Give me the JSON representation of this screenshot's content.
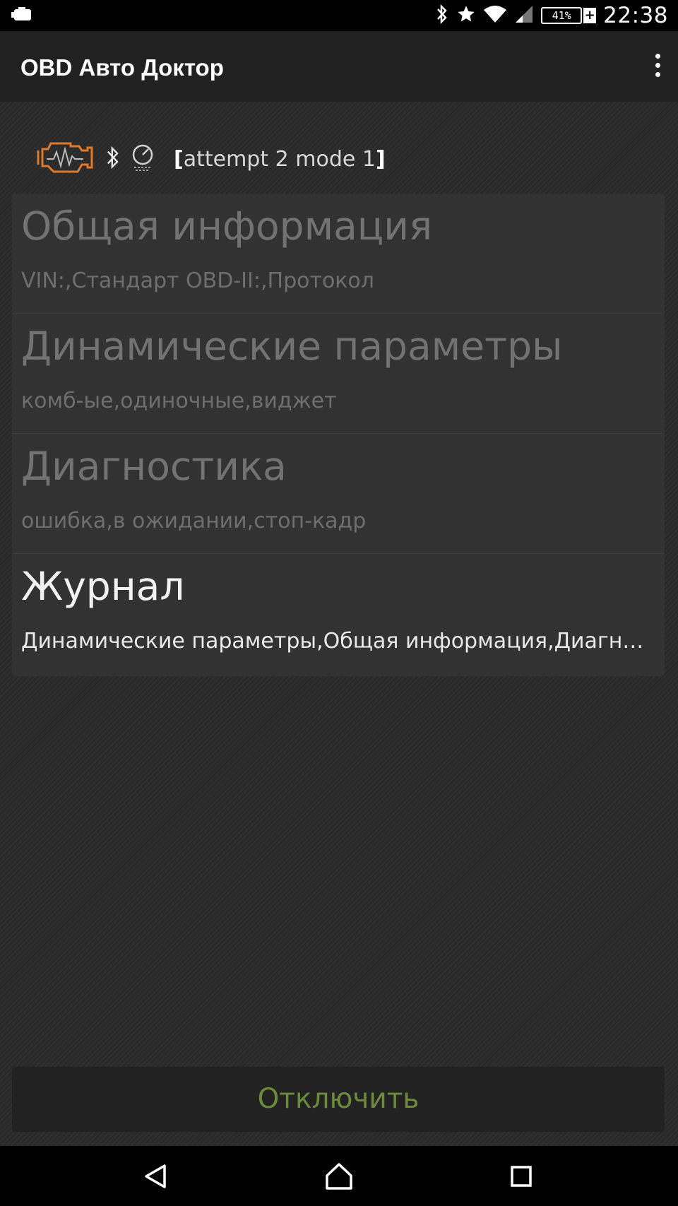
{
  "status_bar": {
    "time": "22:38",
    "battery": "41%",
    "icons": [
      "notification-icon",
      "bluetooth-icon",
      "star-icon",
      "wifi-icon",
      "cellular-signal-icon",
      "battery-icon"
    ]
  },
  "app_bar": {
    "title": "OBD Авто Доктор",
    "overflow_icon": "more-vert-icon"
  },
  "connection": {
    "status": "attempt 2 mode 1",
    "bracket_open": "[",
    "bracket_close": "]",
    "icons": [
      "engine-check-icon",
      "bluetooth-icon",
      "gauge-icon"
    ],
    "engine_icon_color": "#e07a2a"
  },
  "menu": [
    {
      "title": "Общая информация",
      "subtitle": "VIN:,Стандарт OBD-II:,Протокол",
      "enabled": false
    },
    {
      "title": "Динамические параметры",
      "subtitle": "комб-ые,одиночные,виджет",
      "enabled": false
    },
    {
      "title": "Диагностика",
      "subtitle": "ошибка,в ожидании,стоп-кадр",
      "enabled": false
    },
    {
      "title": "Журнал",
      "subtitle": "Динамические параметры,Общая информация,Диагн…",
      "enabled": true
    }
  ],
  "disconnect_button": {
    "label": "Отключить",
    "color": "#6b8a3a"
  },
  "nav_bar": {
    "icons": [
      "back-icon",
      "home-icon",
      "recents-icon"
    ]
  }
}
